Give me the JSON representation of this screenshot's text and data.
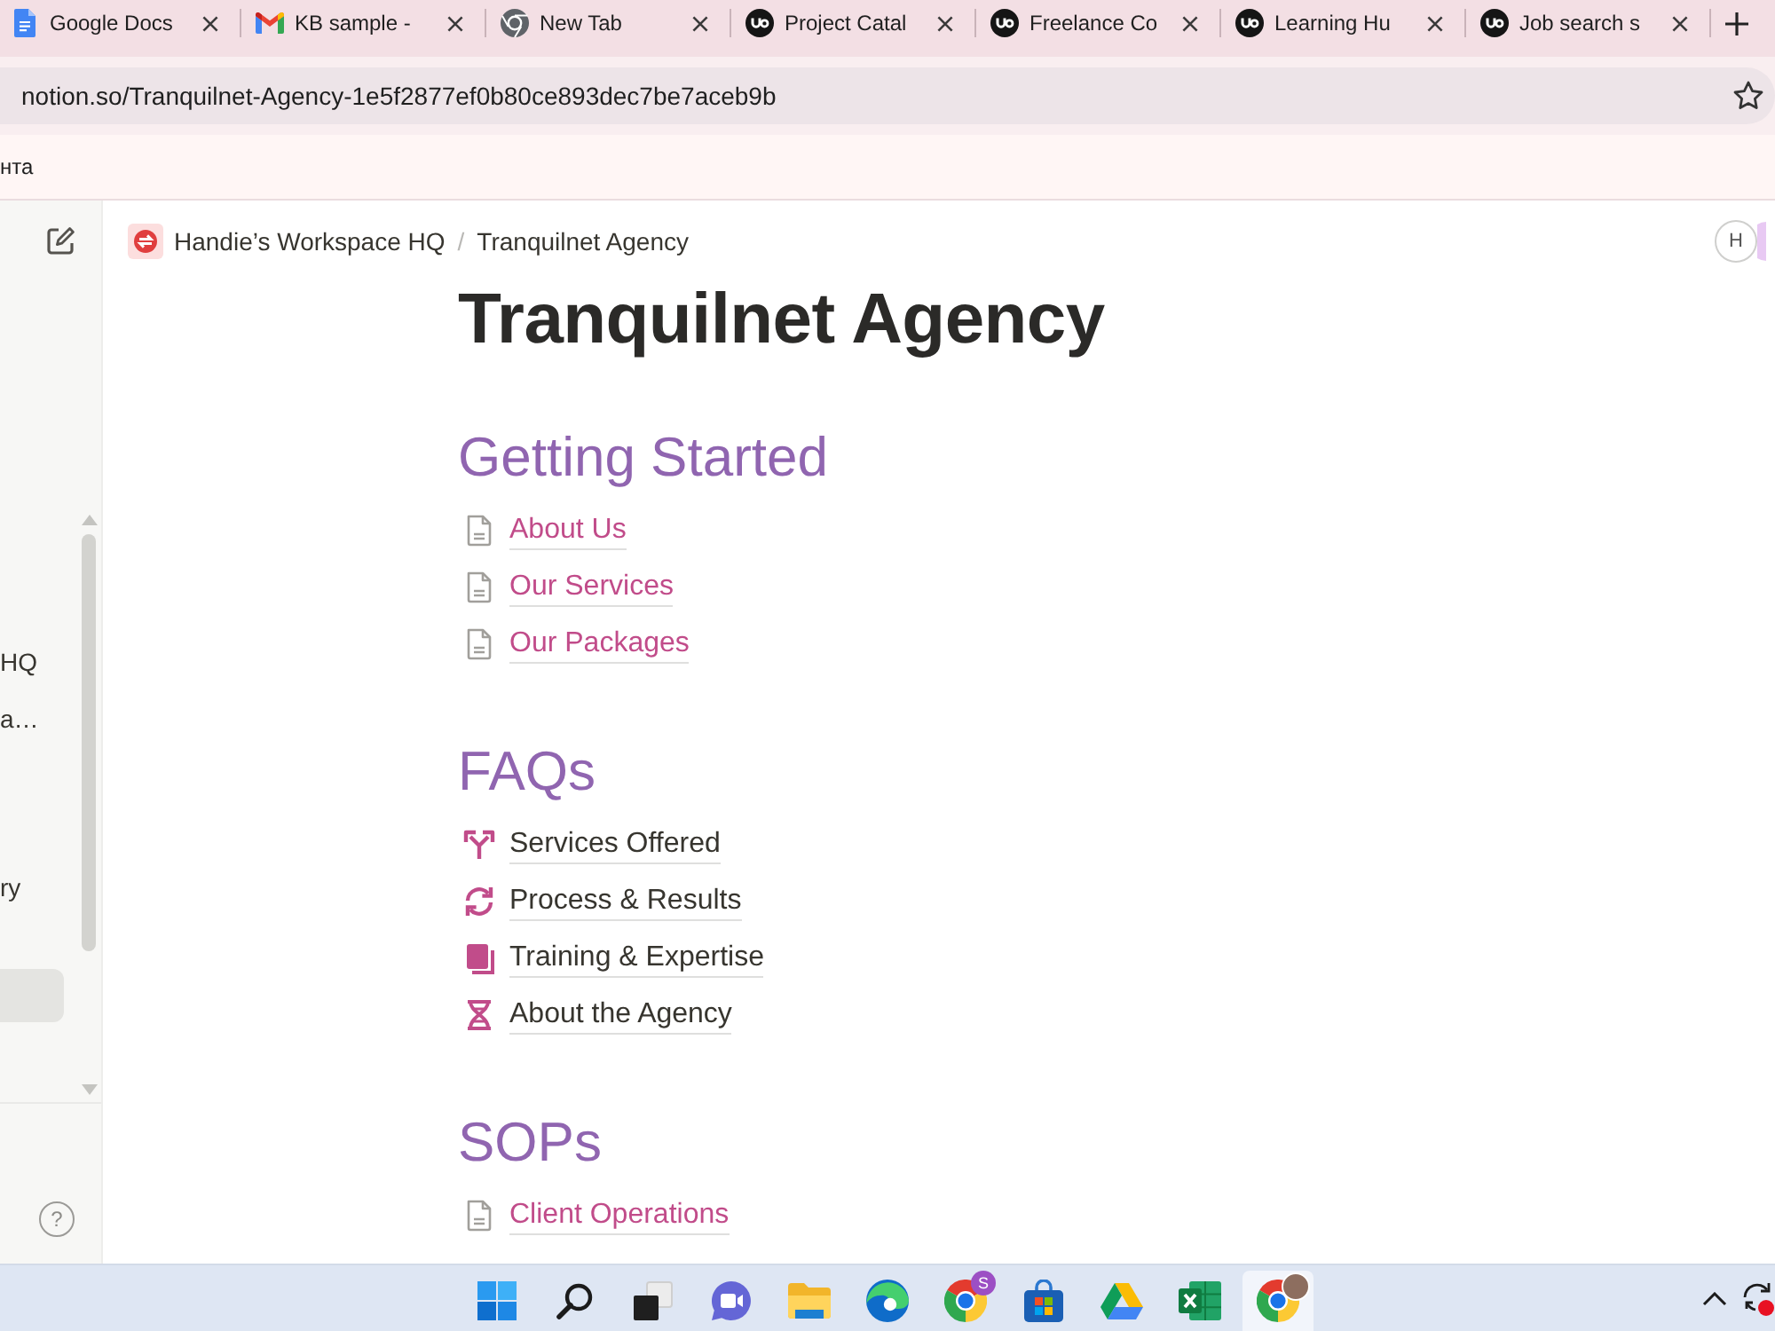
{
  "browser": {
    "tabs": [
      {
        "title": "Google Docs",
        "kind": "doc"
      },
      {
        "title": "KB sample -",
        "kind": "mail"
      },
      {
        "title": "New Tab",
        "kind": "blank"
      },
      {
        "title": "Project Catal",
        "kind": "logo"
      },
      {
        "title": "Freelance Co",
        "kind": "logo"
      },
      {
        "title": "Learning Hu",
        "kind": "logo"
      },
      {
        "title": "Job search s",
        "kind": "logo"
      }
    ],
    "address": "notion.so/Tranquilnet-Agency-1e5f2877ef0b80ce893dec7be7aceb9b",
    "bookmarks": [
      "нта"
    ]
  },
  "sidebar": {
    "items": [
      {
        "label": "HQ",
        "selected": false
      },
      {
        "label": "a…",
        "selected": false
      },
      {
        "label": "ry",
        "selected": false
      },
      {
        "selected": true
      }
    ],
    "help": "?"
  },
  "breadcrumb": {
    "items": [
      "Handie’s Workspace HQ",
      "Tranquilnet Agency"
    ],
    "separator": "/"
  },
  "avatar": "H",
  "page": {
    "title": "Tranquilnet Agency",
    "sections": [
      {
        "heading": "Getting Started",
        "items": [
          {
            "label": "About Us",
            "kind": "page"
          },
          {
            "label": "Our Services",
            "kind": "page"
          },
          {
            "label": "Our Packages",
            "kind": "page"
          }
        ]
      },
      {
        "heading": "FAQs",
        "items": [
          {
            "label": "Services Offered",
            "kind": "split"
          },
          {
            "label": "Process & Results",
            "kind": "refresh"
          },
          {
            "label": "Training & Expertise",
            "kind": "book"
          },
          {
            "label": "About the Agency",
            "kind": "dna"
          }
        ]
      },
      {
        "heading": "SOPs",
        "items": [
          {
            "label": "Client Operations",
            "kind": "page"
          }
        ]
      }
    ]
  },
  "taskbar": {
    "apps": [
      {
        "kind": "start",
        "active": false
      },
      {
        "kind": "search",
        "active": false
      },
      {
        "kind": "taskview",
        "active": false
      },
      {
        "kind": "chat",
        "active": false
      },
      {
        "kind": "files",
        "active": false
      },
      {
        "kind": "edge",
        "active": false
      },
      {
        "kind": "chrome",
        "active": false,
        "badge": "S"
      },
      {
        "kind": "store",
        "active": false
      },
      {
        "kind": "drive",
        "active": false
      },
      {
        "kind": "sheet",
        "active": false
      },
      {
        "kind": "chrome",
        "active": true,
        "photo_badge": true
      }
    ]
  }
}
